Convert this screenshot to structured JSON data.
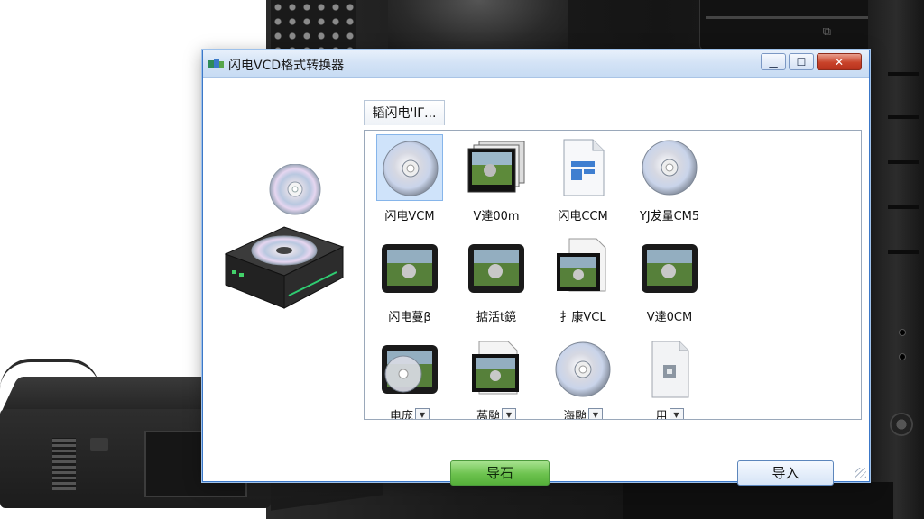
{
  "window": {
    "title": "闪电VCD格式转换器",
    "controls": {
      "minimize": "▁",
      "maximize": "☐",
      "close": "✕"
    }
  },
  "path_tab": {
    "label": "韬闪电'lΓ..."
  },
  "files": [
    {
      "label": "闪电VCM",
      "icon": "cd-disc-icon",
      "selected": true
    },
    {
      "label": "V達00m",
      "icon": "photo-stack-icon"
    },
    {
      "label": "闪电CCM",
      "icon": "document-icon"
    },
    {
      "label": "YJ犮量CM5",
      "icon": "cd-disc-icon"
    },
    {
      "label": "闪电蔓β",
      "icon": "video-thumbnail-icon"
    },
    {
      "label": "掂活t鏡",
      "icon": "video-thumbnail-icon"
    },
    {
      "label": "扌康VCL",
      "icon": "video-file-icon"
    },
    {
      "label": "V達0CM",
      "icon": "video-thumbnail-icon"
    },
    {
      "label": "电庞",
      "icon": "disc-video-icon",
      "dropdown": true
    },
    {
      "label": "萵颱",
      "icon": "video-file-icon",
      "dropdown": true
    },
    {
      "label": "海颱",
      "icon": "cd-disc-icon",
      "dropdown": true
    },
    {
      "label": "用",
      "icon": "blank-file-icon",
      "dropdown": true
    }
  ],
  "buttons": {
    "export": "导石",
    "import": "导入"
  },
  "colors": {
    "accent_blue": "#3c78c8",
    "export_green": "#6cc24e",
    "selection": "#cfe3fa"
  }
}
